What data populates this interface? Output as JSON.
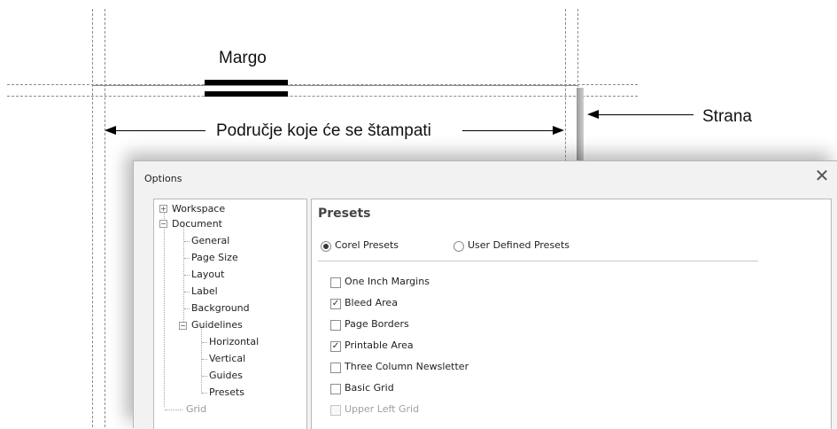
{
  "diagram": {
    "margin_label": "Margo",
    "printable_label": "Područje koje će se štampati",
    "page_label": "Strana"
  },
  "dialog": {
    "title": "Options",
    "close_glyph": "✕",
    "tree": [
      {
        "label": "Workspace",
        "expander": "+"
      },
      {
        "label": "Document",
        "expander": "−"
      },
      {
        "label": "General"
      },
      {
        "label": "Page Size"
      },
      {
        "label": "Layout"
      },
      {
        "label": "Label"
      },
      {
        "label": "Background"
      },
      {
        "label": "Guidelines",
        "expander": "−"
      },
      {
        "label": "Horizontal"
      },
      {
        "label": "Vertical"
      },
      {
        "label": "Guides"
      },
      {
        "label": "Presets",
        "selected": true
      },
      {
        "label": "Grid",
        "disabled": true
      }
    ],
    "content": {
      "section_title": "Presets",
      "radios": [
        {
          "label": "Corel Presets",
          "checked": true
        },
        {
          "label": "User Defined Presets",
          "checked": false
        }
      ],
      "checkboxes": [
        {
          "label": "One Inch Margins",
          "checked": false
        },
        {
          "label": "Bleed Area",
          "checked": true
        },
        {
          "label": "Page Borders",
          "checked": false
        },
        {
          "label": "Printable Area",
          "checked": true
        },
        {
          "label": "Three Column Newsletter",
          "checked": false
        },
        {
          "label": "Basic Grid",
          "checked": false
        },
        {
          "label": "Upper Left Grid",
          "checked": false,
          "disabled": true
        }
      ]
    }
  }
}
